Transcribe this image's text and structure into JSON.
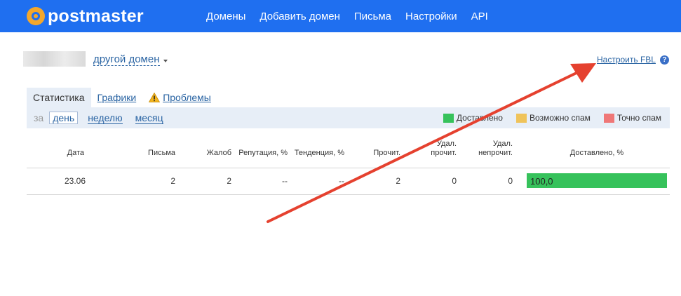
{
  "header": {
    "logo_text": "postmaster",
    "nav": [
      "Домены",
      "Добавить домен",
      "Письма",
      "Настройки",
      "API"
    ]
  },
  "domain": {
    "switch_label": "другой домен",
    "fbl_link": "Настроить FBL",
    "help_glyph": "?"
  },
  "tabs": [
    "Статистика",
    "Графики",
    "Проблемы"
  ],
  "period": {
    "prefix": "за",
    "options": [
      "день",
      "неделю",
      "месяц"
    ],
    "selected": "день"
  },
  "legend": [
    {
      "label": "Доставлено",
      "color": "#36c25b"
    },
    {
      "label": "Возможно спам",
      "color": "#efc35a"
    },
    {
      "label": "Точно спам",
      "color": "#ef7777"
    }
  ],
  "table": {
    "headers": [
      "Дата",
      "Письма",
      "Жалоб",
      "Репутация, %",
      "Тенденция, %",
      "Прочит.",
      "Удал.\nпрочит.",
      "Удал.\nнепрочит.",
      "Доставлено, %"
    ],
    "rows": [
      {
        "date": "23.06",
        "letters": "2",
        "complaints": "2",
        "reputation": "--",
        "trend": "--",
        "read": "2",
        "del_read": "0",
        "del_unread": "0",
        "delivered": "100,0",
        "delivered_fraction": 1.0
      }
    ]
  },
  "colors": {
    "topbar": "#1f6ff0",
    "link": "#2a64a3",
    "arrow": "#e5412f"
  }
}
